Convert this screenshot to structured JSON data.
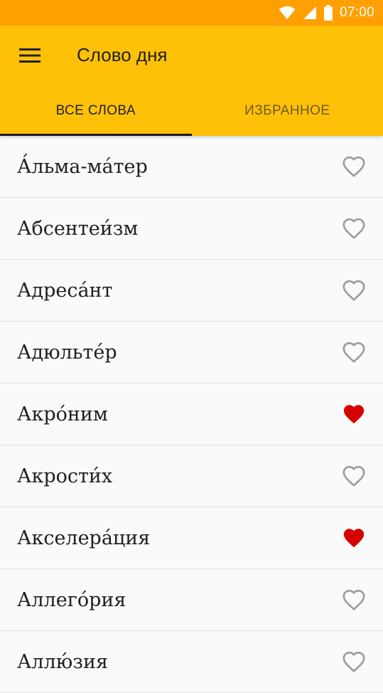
{
  "status_bar": {
    "time": "07:00",
    "icons": [
      "wifi-icon",
      "signal-icon",
      "battery-icon"
    ]
  },
  "app_bar": {
    "menu_icon": "hamburger-menu-icon",
    "title": "Слово дня"
  },
  "tabs": [
    {
      "label": "ВСЕ СЛОВА",
      "active": true
    },
    {
      "label": "ИЗБРАННОЕ",
      "active": false
    }
  ],
  "colors": {
    "status_bar": "#ffa000",
    "app_bar": "#ffc107",
    "favorite_active": "#d50000",
    "favorite_inactive": "#9e9e9e"
  },
  "words": [
    {
      "word": "А́льма-ма́тер",
      "favorite": false
    },
    {
      "word": "Абсентеи́зм",
      "favorite": false
    },
    {
      "word": "Адреса́нт",
      "favorite": false
    },
    {
      "word": "Адюльте́р",
      "favorite": false
    },
    {
      "word": "Акро́ним",
      "favorite": true
    },
    {
      "word": "Акрости́х",
      "favorite": false
    },
    {
      "word": "Акселера́ция",
      "favorite": true
    },
    {
      "word": "Аллего́рия",
      "favorite": false
    },
    {
      "word": "Аллю́зия",
      "favorite": false
    }
  ]
}
